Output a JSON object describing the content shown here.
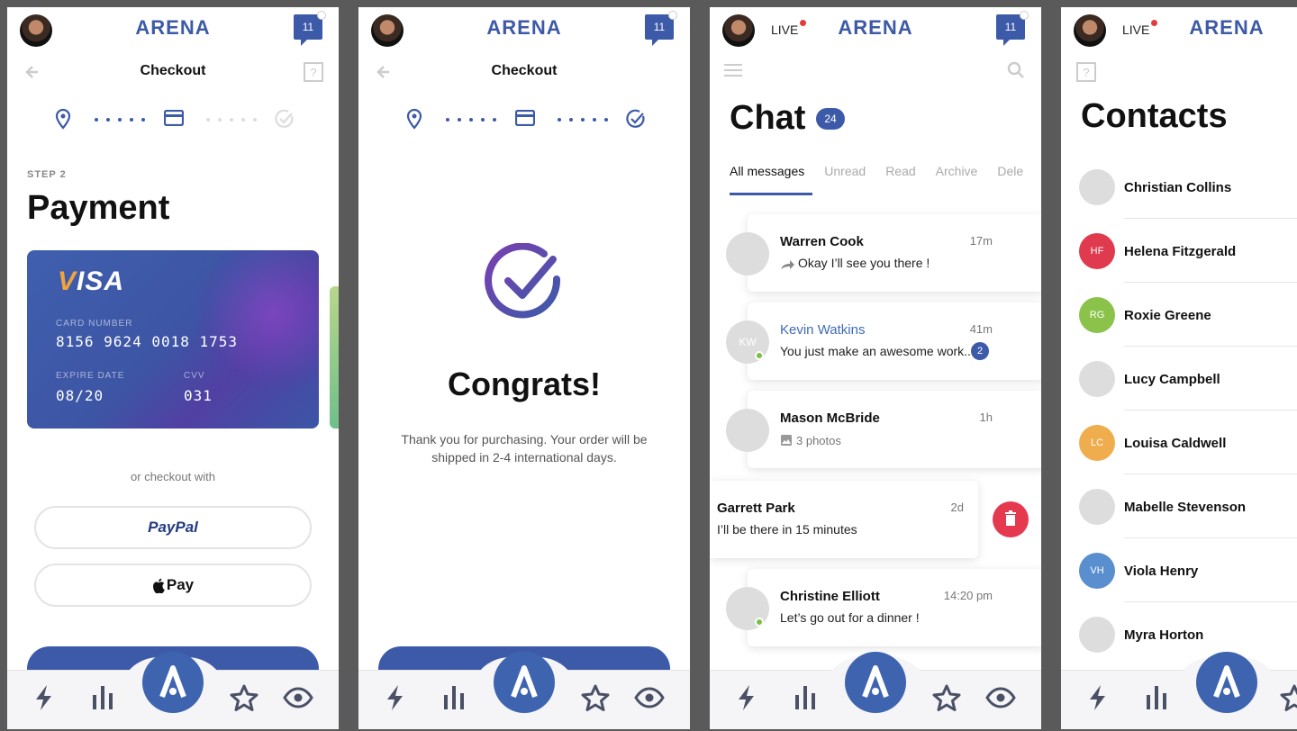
{
  "brand": {
    "logo_text": "ARENA",
    "accent": "#3d5aa8",
    "notifications_count": "11",
    "live_label": "LIVE"
  },
  "checkout": {
    "title": "Checkout",
    "step_label": "STEP 2",
    "heading": "Payment",
    "card": {
      "brand": "VISA",
      "number_label": "CARD NUMBER",
      "number": "8156 9624 0018 1753",
      "expire_label": "EXPIRE DATE",
      "expire": "08/20",
      "cvv_label": "CVV",
      "cvv": "031"
    },
    "or_text": "or checkout with",
    "paypal_label": "PayPal",
    "applepay_label": "Pay"
  },
  "congrats": {
    "title": "Checkout",
    "heading": "Congrats!",
    "message": "Thank you for purchasing. Your order will be shipped in 2-4 international days."
  },
  "chat": {
    "heading": "Chat",
    "badge": "24",
    "tabs": [
      "All messages",
      "Unread",
      "Read",
      "Archive",
      "Dele"
    ],
    "messages": [
      {
        "name": "Warren Cook",
        "time": "17m",
        "text": "Okay I’ll see you there !"
      },
      {
        "name": "Kevin Watkins",
        "initials": "KW",
        "time": "41m",
        "text": "You just make an awesome work...",
        "count": "2"
      },
      {
        "name": "Mason McBride",
        "time": "1h",
        "text": "3 photos"
      },
      {
        "name": "Garrett Park",
        "time": "2d",
        "text": "I’ll be there in 15 minutes"
      },
      {
        "name": "Christine Elliott",
        "time": "14:20 pm",
        "text": "Let’s go out for a dinner !"
      }
    ]
  },
  "contacts": {
    "heading": "Contacts",
    "items": [
      {
        "name": "Christian Collins",
        "initials": "",
        "color": "#dddddd"
      },
      {
        "name": "Helena Fitzgerald",
        "initials": "HF",
        "color": "#e03a4e"
      },
      {
        "name": "Roxie Greene",
        "initials": "RG",
        "color": "#8bc34a"
      },
      {
        "name": "Lucy Campbell",
        "initials": "",
        "color": "#dddddd"
      },
      {
        "name": "Louisa Caldwell",
        "initials": "LC",
        "color": "#f0ad4e"
      },
      {
        "name": "Mabelle Stevenson",
        "initials": "",
        "color": "#dddddd"
      },
      {
        "name": "Viola Henry",
        "initials": "VH",
        "color": "#5a8fcf"
      },
      {
        "name": "Myra Horton",
        "initials": "",
        "color": "#dddddd"
      }
    ]
  }
}
